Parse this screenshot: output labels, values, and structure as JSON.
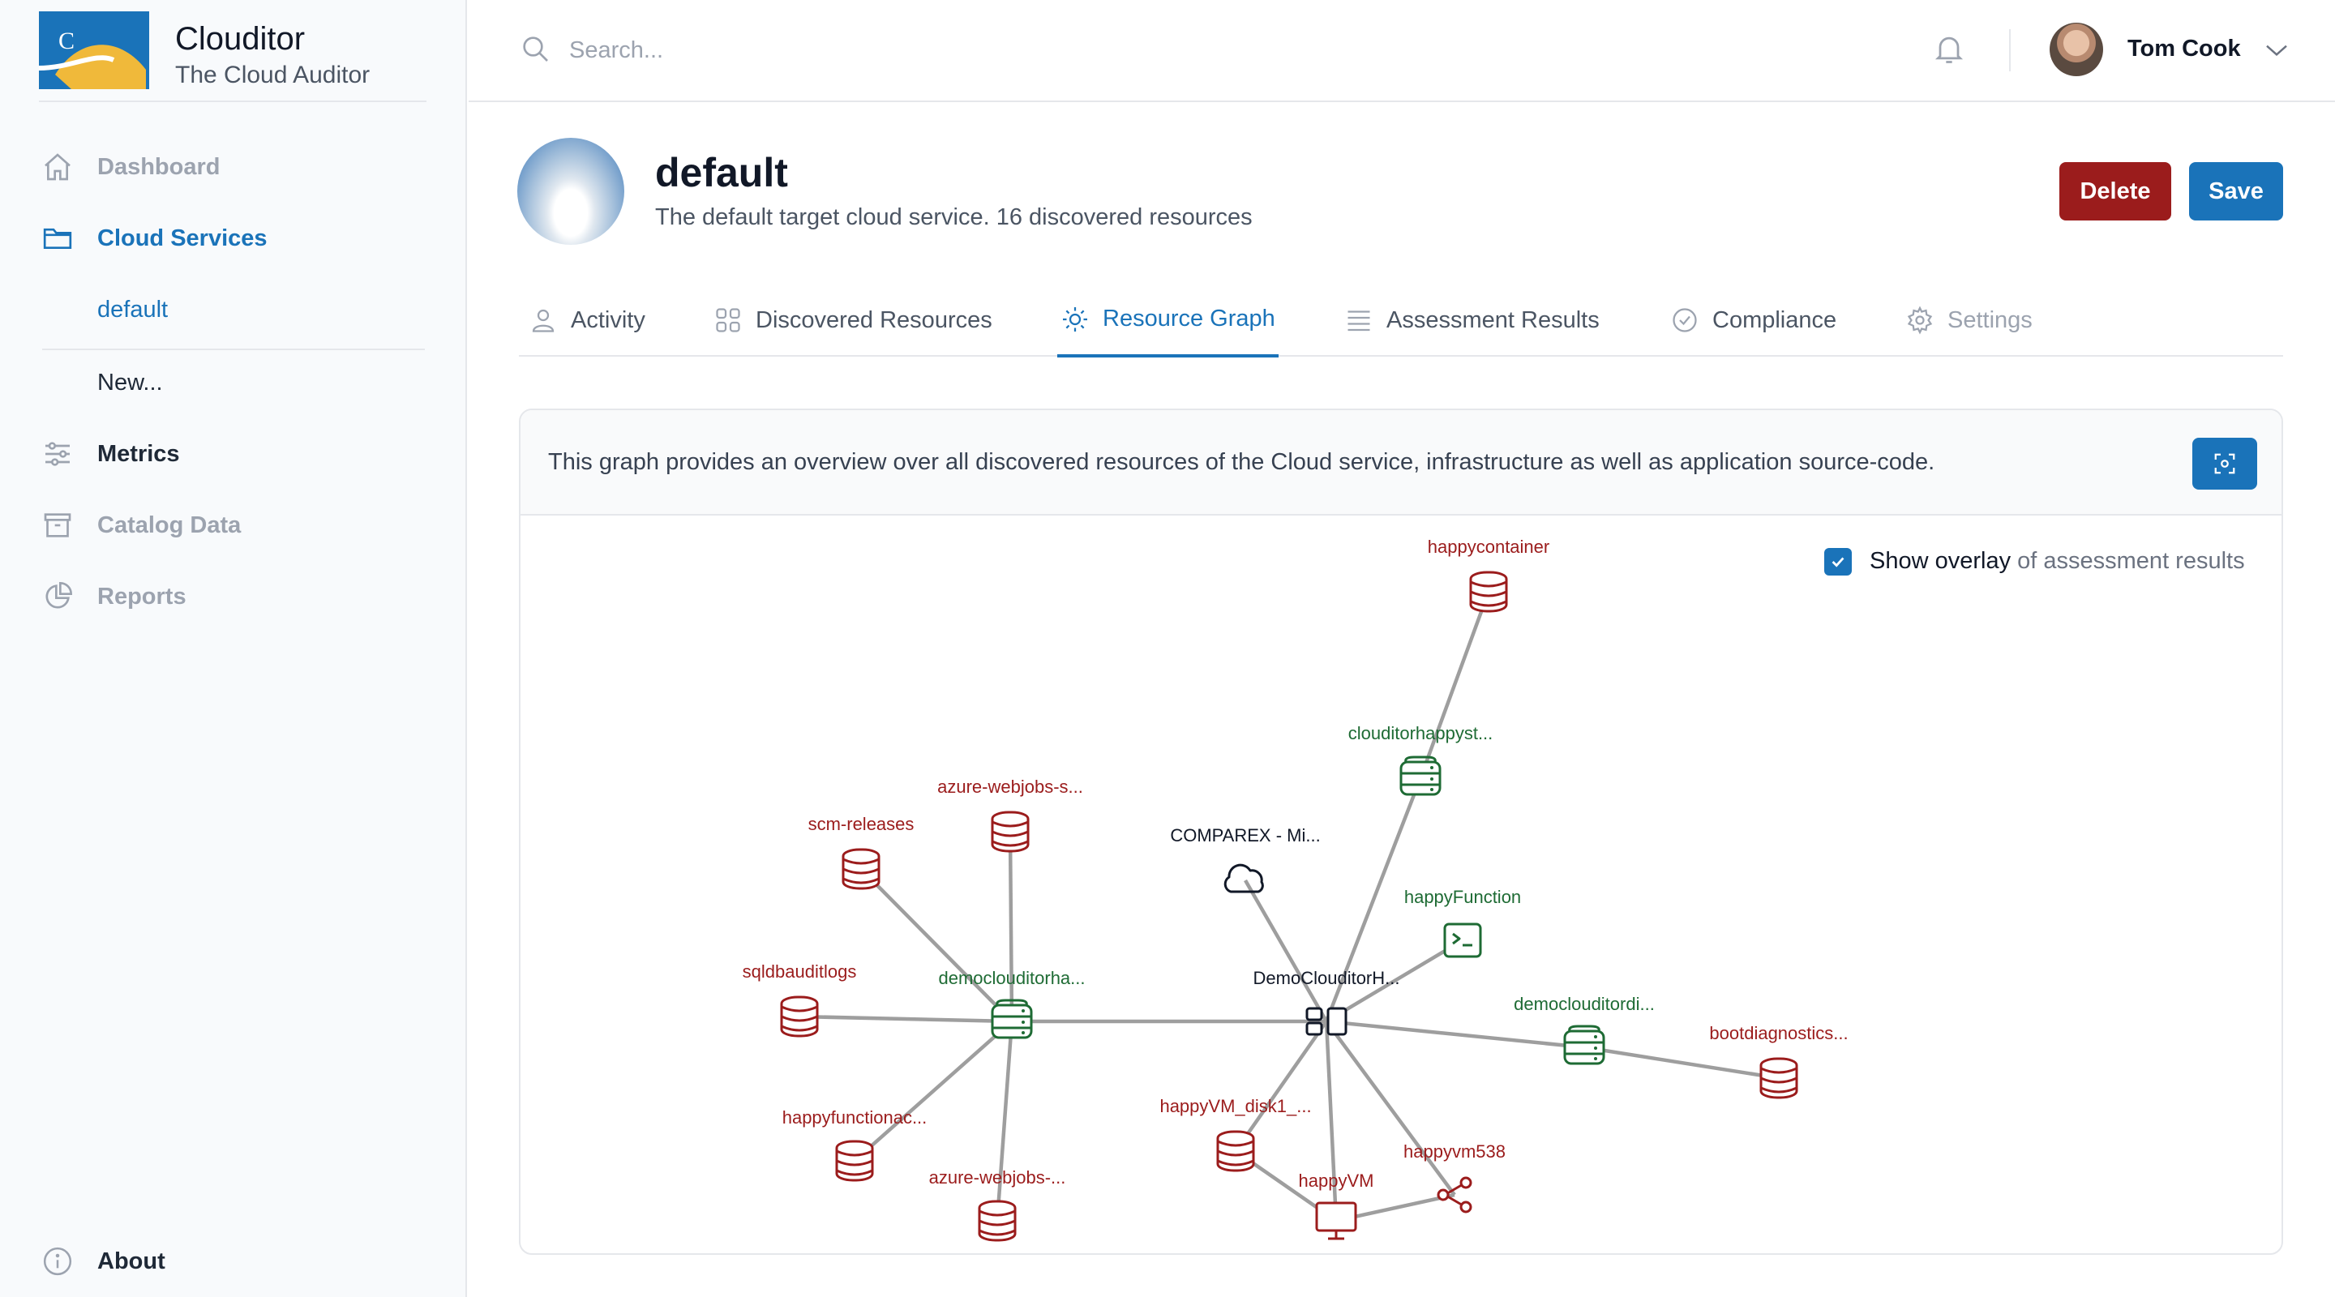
{
  "app": {
    "name": "Clouditor",
    "subtitle": "The Cloud Auditor"
  },
  "sidebar": {
    "items": [
      {
        "label": "Dashboard",
        "icon": "home-icon"
      },
      {
        "label": "Cloud Services",
        "icon": "folder-icon"
      },
      {
        "label": "Metrics",
        "icon": "sliders-icon"
      },
      {
        "label": "Catalog Data",
        "icon": "archive-icon"
      },
      {
        "label": "Reports",
        "icon": "pie-chart-icon"
      }
    ],
    "sub_items": [
      {
        "label": "default"
      },
      {
        "label": "New..."
      }
    ],
    "about": {
      "label": "About",
      "icon": "info-icon"
    }
  },
  "header": {
    "search_placeholder": "Search...",
    "user_name": "Tom Cook"
  },
  "service": {
    "title": "default",
    "description": "The default target cloud service. 16 discovered resources",
    "delete_label": "Delete",
    "save_label": "Save"
  },
  "tabs": [
    {
      "label": "Activity",
      "icon": "user-icon"
    },
    {
      "label": "Discovered Resources",
      "icon": "grid-icon"
    },
    {
      "label": "Resource Graph",
      "icon": "sun-icon"
    },
    {
      "label": "Assessment Results",
      "icon": "list-icon"
    },
    {
      "label": "Compliance",
      "icon": "check-circle-icon"
    },
    {
      "label": "Settings",
      "icon": "gear-icon"
    }
  ],
  "graph_card": {
    "description": "This graph provides an overview over all discovered resources of the Cloud service, infrastructure as well as application source-code.",
    "overlay_label_bold": "Show overlay",
    "overlay_label_rest": " of assessment results",
    "overlay_checked": true
  },
  "colors": {
    "accent": "#1a73b9",
    "danger": "#9b1c1c",
    "fail": "#9b1c1c",
    "ok": "#1e6b34",
    "neutral": "#111827"
  },
  "graph": {
    "nodes": [
      {
        "id": "happycontainer",
        "label": "happycontainer",
        "type": "storage",
        "status": "fail"
      },
      {
        "id": "clouditorhappyst",
        "label": "clouditorhappyst...",
        "type": "storage-account",
        "status": "ok"
      },
      {
        "id": "azure-webjobs-s",
        "label": "azure-webjobs-s...",
        "type": "storage",
        "status": "fail"
      },
      {
        "id": "scm-releases",
        "label": "scm-releases",
        "type": "storage",
        "status": "fail"
      },
      {
        "id": "comparex",
        "label": "COMPAREX - Mi...",
        "type": "cloud",
        "status": "neutral"
      },
      {
        "id": "happyFunction",
        "label": "happyFunction",
        "type": "function",
        "status": "ok"
      },
      {
        "id": "sqldbauditlogs",
        "label": "sqldbauditlogs",
        "type": "storage",
        "status": "fail"
      },
      {
        "id": "democlouditorha",
        "label": "democlouditorha...",
        "type": "storage-account",
        "status": "ok"
      },
      {
        "id": "DemoClouditorH",
        "label": "DemoClouditorH...",
        "type": "resource-group",
        "status": "neutral"
      },
      {
        "id": "democlouditordi",
        "label": "democlouditordi...",
        "type": "storage-account",
        "status": "ok"
      },
      {
        "id": "bootdiagnostics",
        "label": "bootdiagnostics...",
        "type": "storage",
        "status": "fail"
      },
      {
        "id": "happyVM_disk1",
        "label": "happyVM_disk1_...",
        "type": "storage",
        "status": "fail"
      },
      {
        "id": "happyfunctionac",
        "label": "happyfunctionac...",
        "type": "storage",
        "status": "fail"
      },
      {
        "id": "happyvm538",
        "label": "happyvm538",
        "type": "network-interface",
        "status": "fail"
      },
      {
        "id": "happyVM",
        "label": "happyVM",
        "type": "vm",
        "status": "fail"
      },
      {
        "id": "azure-webjobs-2",
        "label": "azure-webjobs-...",
        "type": "storage",
        "status": "fail"
      }
    ],
    "edges": [
      [
        "happycontainer",
        "clouditorhappyst"
      ],
      [
        "clouditorhappyst",
        "DemoClouditorH"
      ],
      [
        "comparex",
        "DemoClouditorH"
      ],
      [
        "happyFunction",
        "DemoClouditorH"
      ],
      [
        "democlouditorha",
        "DemoClouditorH"
      ],
      [
        "scm-releases",
        "democlouditorha"
      ],
      [
        "azure-webjobs-s",
        "democlouditorha"
      ],
      [
        "sqldbauditlogs",
        "democlouditorha"
      ],
      [
        "happyfunctionac",
        "democlouditorha"
      ],
      [
        "azure-webjobs-2",
        "democlouditorha"
      ],
      [
        "democlouditordi",
        "DemoClouditorH"
      ],
      [
        "bootdiagnostics",
        "democlouditordi"
      ],
      [
        "happyVM_disk1",
        "DemoClouditorH"
      ],
      [
        "happyVM",
        "DemoClouditorH"
      ],
      [
        "happyvm538",
        "DemoClouditorH"
      ],
      [
        "happyVM_disk1",
        "happyVM"
      ],
      [
        "happyvm538",
        "happyVM"
      ]
    ]
  }
}
